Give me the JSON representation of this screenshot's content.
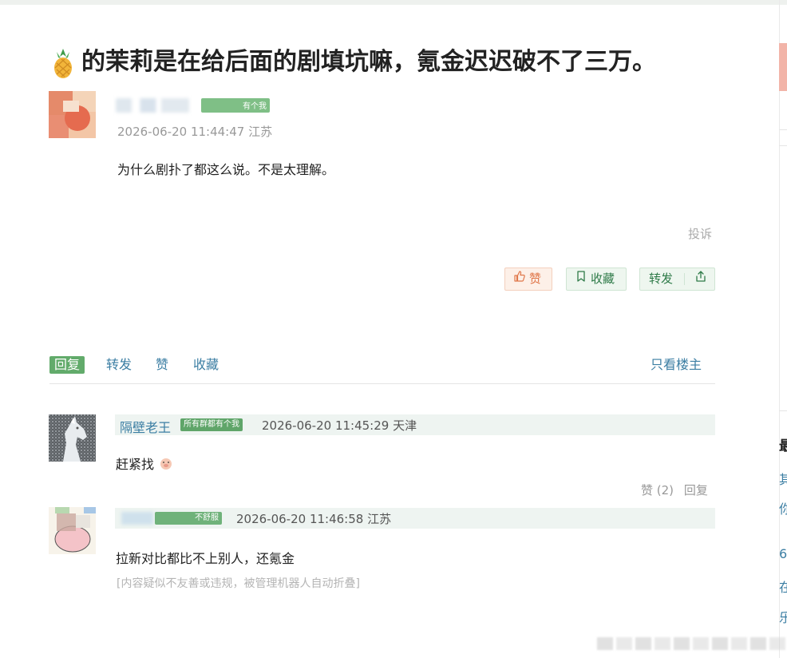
{
  "post": {
    "title": "的茉莉是在给后面的剧填坑嘛，氪金迟迟破不了三万。",
    "title_icon": "pineapple-icon",
    "time_location": "2026-06-20 11:44:47 江苏",
    "body": "为什么剧扑了都这么说。不是太理解。",
    "badge_partial": "有个我",
    "report": "投诉"
  },
  "actions": {
    "like": "赞",
    "favorite": "收藏",
    "share": "转发"
  },
  "tabs": {
    "reply": "回复",
    "share": "转发",
    "like": "赞",
    "favorite": "收藏",
    "only_op": "只看楼主"
  },
  "replies": [
    {
      "user": "隔壁老王",
      "badge": "所有群都有个我",
      "time_location": "2026-06-20 11:45:29 天津",
      "body": "赶紧找",
      "likes": "赞 (2)",
      "reply_label": "回复"
    },
    {
      "badge_partial": "不舒服",
      "time_location": "2026-06-20 11:46:58 江苏",
      "body": "拉新对比都比不上别人，还氪金",
      "folded_note": "[内容疑似不友善或违规，被管理机器人自动折叠]"
    }
  ],
  "colors": {
    "accent_green": "#62ab6b",
    "link_blue": "#3b7ea3",
    "like_orange": "#e0774a"
  }
}
